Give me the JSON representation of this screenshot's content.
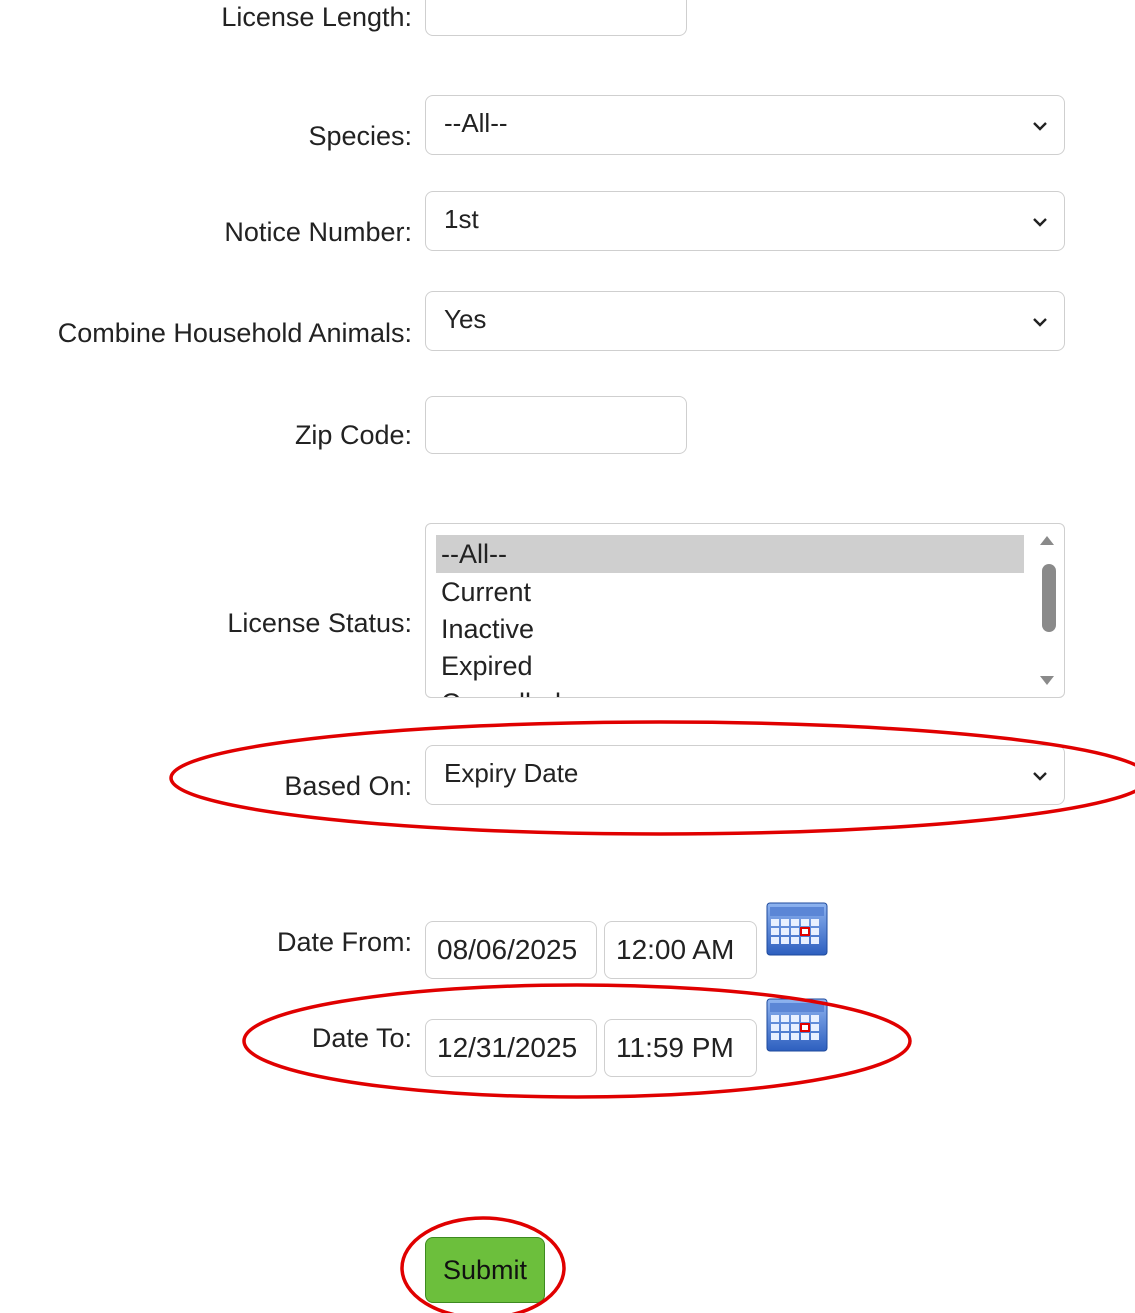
{
  "form": {
    "license_length": {
      "label": "License Length:",
      "value": ""
    },
    "species": {
      "label": "Species:",
      "value": "--All--"
    },
    "notice_number": {
      "label": "Notice Number:",
      "value": "1st"
    },
    "combine_household": {
      "label": "Combine Household Animals:",
      "value": "Yes"
    },
    "zip_code": {
      "label": "Zip Code:",
      "value": ""
    },
    "license_status": {
      "label": "License Status:",
      "options": [
        "--All--",
        "Current",
        "Inactive",
        "Expired",
        "Cancelled"
      ],
      "selected": "--All--"
    },
    "based_on": {
      "label": "Based On:",
      "value": "Expiry Date"
    },
    "date_from": {
      "label": "Date From:",
      "date": "08/06/2025",
      "time": "12:00 AM"
    },
    "date_to": {
      "label": "Date To:",
      "date": "12/31/2025",
      "time": "11:59 PM"
    },
    "submit_label": "Submit"
  },
  "icons": {
    "calendar": "calendar-icon",
    "dropdown": "chevron-down-icon"
  },
  "colors": {
    "annotation": "#e00000",
    "submit": "#6cbf3c"
  }
}
